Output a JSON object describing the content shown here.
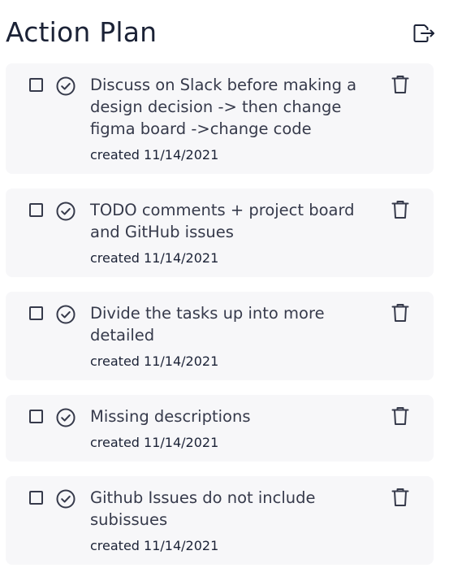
{
  "header": {
    "title": "Action Plan",
    "export_icon": "export-file-icon"
  },
  "colors": {
    "card_background": "#f7f7f9",
    "text_primary": "#363a4b",
    "title": "#1b2236"
  },
  "tasks": [
    {
      "text": "Discuss on Slack before making a design decision -> then change figma board ->change code",
      "date": "created 11/14/2021"
    },
    {
      "text": "TODO comments + project board and GitHub issues",
      "date": "created 11/14/2021"
    },
    {
      "text": "Divide the tasks up into more detailed",
      "date": "created 11/14/2021"
    },
    {
      "text": "Missing descriptions",
      "date": "created 11/14/2021"
    },
    {
      "text": "Github Issues do not include subissues",
      "date": "created 11/14/2021"
    }
  ],
  "icons": {
    "checkbox": "checkbox-icon",
    "complete": "check-circle-icon",
    "delete": "trash-icon"
  }
}
